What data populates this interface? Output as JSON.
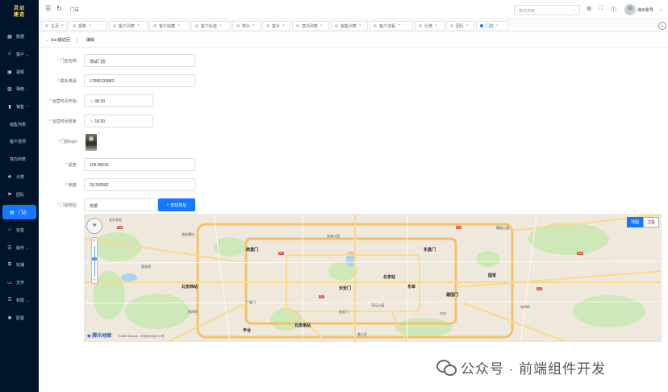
{
  "sidebar": {
    "logo_line1": "灵动",
    "logo_line2": "建造",
    "items": [
      {
        "label": "数据",
        "icon": "dashboard-icon"
      },
      {
        "label": "客户",
        "icon": "user-icon",
        "expand": true
      },
      {
        "label": "视频",
        "icon": "video-icon"
      },
      {
        "label": "相册",
        "icon": "image-icon",
        "expand": true
      },
      {
        "label": "销售",
        "icon": "chart-icon",
        "expand": true,
        "open": true
      },
      {
        "label": "销售列表",
        "sub": true
      },
      {
        "label": "客户选项",
        "sub": true
      },
      {
        "label": "意向列表",
        "sub": true
      },
      {
        "label": "分类",
        "icon": "category-icon"
      },
      {
        "label": "团队",
        "icon": "team-icon"
      },
      {
        "label": "门店",
        "icon": "store-icon",
        "active": true
      },
      {
        "label": "标签",
        "icon": "tag-icon"
      },
      {
        "label": "操作",
        "icon": "operate-icon",
        "expand": true
      },
      {
        "label": "轮播",
        "icon": "carousel-icon"
      },
      {
        "label": "文件",
        "icon": "file-icon"
      },
      {
        "label": "权限",
        "icon": "lock-icon",
        "expand": true
      },
      {
        "label": "配置",
        "icon": "settings-icon"
      }
    ]
  },
  "topbar": {
    "breadcrumb": "门店",
    "search_placeholder": "菜单搜索",
    "user_name": "演示账号"
  },
  "tabs": [
    {
      "label": "主页"
    },
    {
      "label": "报数"
    },
    {
      "label": "客户列表"
    },
    {
      "label": "客户收藏"
    },
    {
      "label": "客户轨迹"
    },
    {
      "label": "样片"
    },
    {
      "label": "客片"
    },
    {
      "label": "意向列表"
    },
    {
      "label": "销售列表"
    },
    {
      "label": "客户流程"
    },
    {
      "label": "分类"
    },
    {
      "label": "团队"
    },
    {
      "label": "门店",
      "active": true
    }
  ],
  "page": {
    "back_label": "Esc键返回",
    "title": "编辑"
  },
  "form": {
    "name_label": "门店名称:",
    "name_value": "测试门店",
    "phone_label": "联系电话:",
    "phone_value": "17685133863",
    "start_label": "运营时间开始:",
    "start_value": "08:30",
    "end_label": "运营时间结束:",
    "end_value": "18:30",
    "logo_label": "门店logo:",
    "lng_label": "经度:",
    "lng_value": "105.95626",
    "lat_label": "纬度:",
    "lat_value": "26.250582",
    "addr_label": "门店地址:",
    "addr_value": "安顺",
    "search_button": "查找地址"
  },
  "map": {
    "type_map": "地图",
    "type_satellite": "卫星",
    "brand": "腾讯地图",
    "copyright": "©2025 Tencent - GS京(2025)1711号",
    "labels": [
      "北京北站",
      "西直门",
      "北京站",
      "海淀黄庄",
      "北海公园",
      "东直门",
      "朝阳公园",
      "莲花池",
      "北京西站",
      "天安门",
      "东单",
      "建国门",
      "国贸",
      "广安门",
      "北京南站",
      "永定门",
      "天坛公园",
      "方庄",
      "丰台",
      "南三环",
      "西四环",
      "东四环"
    ],
    "highways": [
      "G6",
      "G7",
      "G4",
      "S12",
      "G1",
      "G2"
    ]
  },
  "watermark": "公众号 · 前端组件开发"
}
